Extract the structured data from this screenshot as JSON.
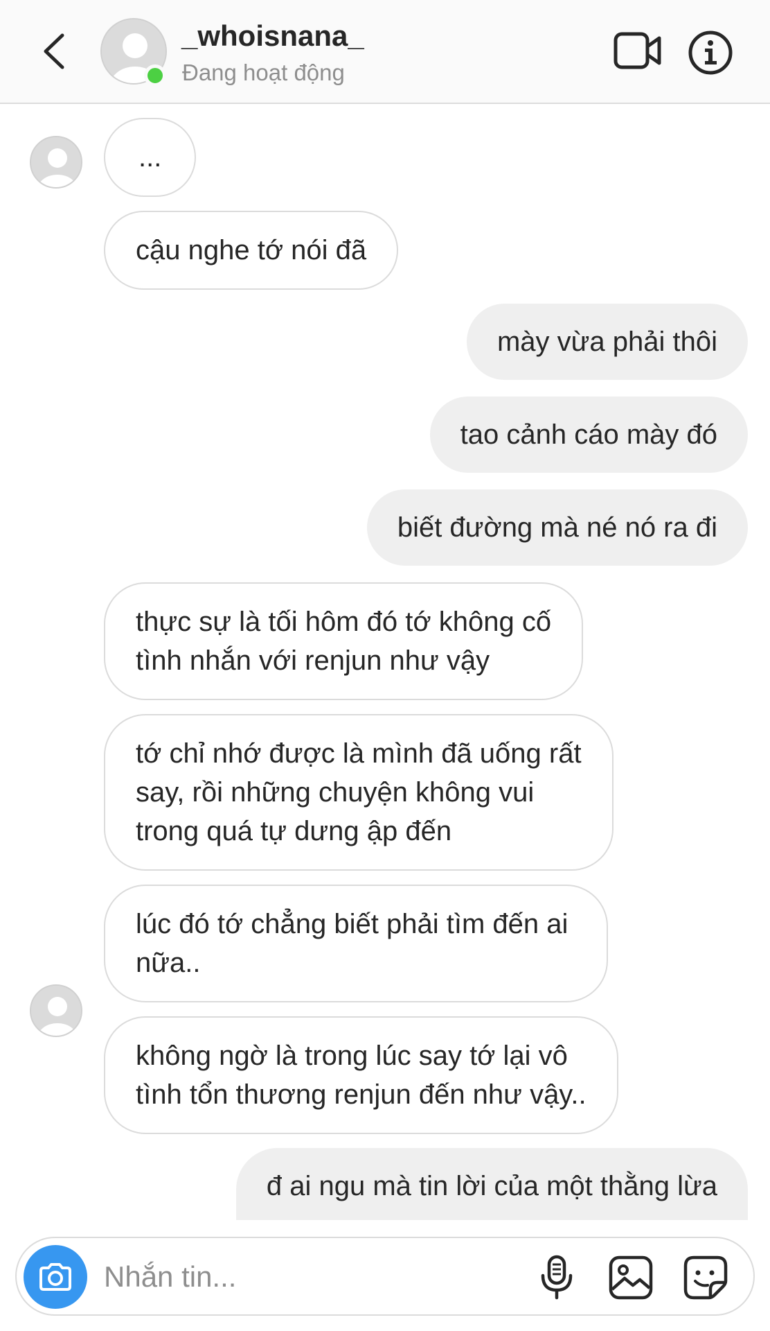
{
  "header": {
    "username": "_whoisnana_",
    "status": "Đang hoạt động",
    "icons": {
      "back": "chevron-left-icon",
      "video": "video-camera-icon",
      "info": "info-icon"
    },
    "online_color": "#4cd043"
  },
  "messages": [
    {
      "side": "in",
      "lines": [
        "..."
      ],
      "avatar": false
    },
    {
      "side": "in",
      "lines": [
        "cậu nghe tớ nói đã"
      ],
      "avatar": true
    },
    {
      "side": "out",
      "lines": [
        "mày vừa phải thôi"
      ]
    },
    {
      "side": "out",
      "lines": [
        "tao cảnh cáo mày đó"
      ]
    },
    {
      "side": "out",
      "lines": [
        "biết đường mà né nó ra đi"
      ]
    },
    {
      "side": "in",
      "lines": [
        "thực sự là tối hôm đó tớ không cố",
        "tình nhắn với renjun như vậy"
      ],
      "avatar": false
    },
    {
      "side": "in",
      "lines": [
        "tớ chỉ nhớ được là mình đã uống rất",
        "say, rồi những chuyện không vui",
        "trong quá tự dưng ập đến"
      ],
      "avatar": false
    },
    {
      "side": "in",
      "lines": [
        "lúc đó tớ chẳng biết phải tìm đến ai",
        "nữa.."
      ],
      "avatar": false
    },
    {
      "side": "in",
      "lines": [
        "không ngờ là trong lúc say tớ lại vô",
        "tình tổn thương renjun đến như vậy.."
      ],
      "avatar": true
    },
    {
      "side": "out",
      "lines": [
        "đ ai ngu mà tin lời của một thằng lừa"
      ]
    }
  ],
  "composer": {
    "placeholder": "Nhắn tin...",
    "accent": "#3797f0",
    "icons": {
      "camera": "camera-icon",
      "mic": "microphone-icon",
      "gallery": "image-icon",
      "sticker": "sticker-icon"
    }
  }
}
